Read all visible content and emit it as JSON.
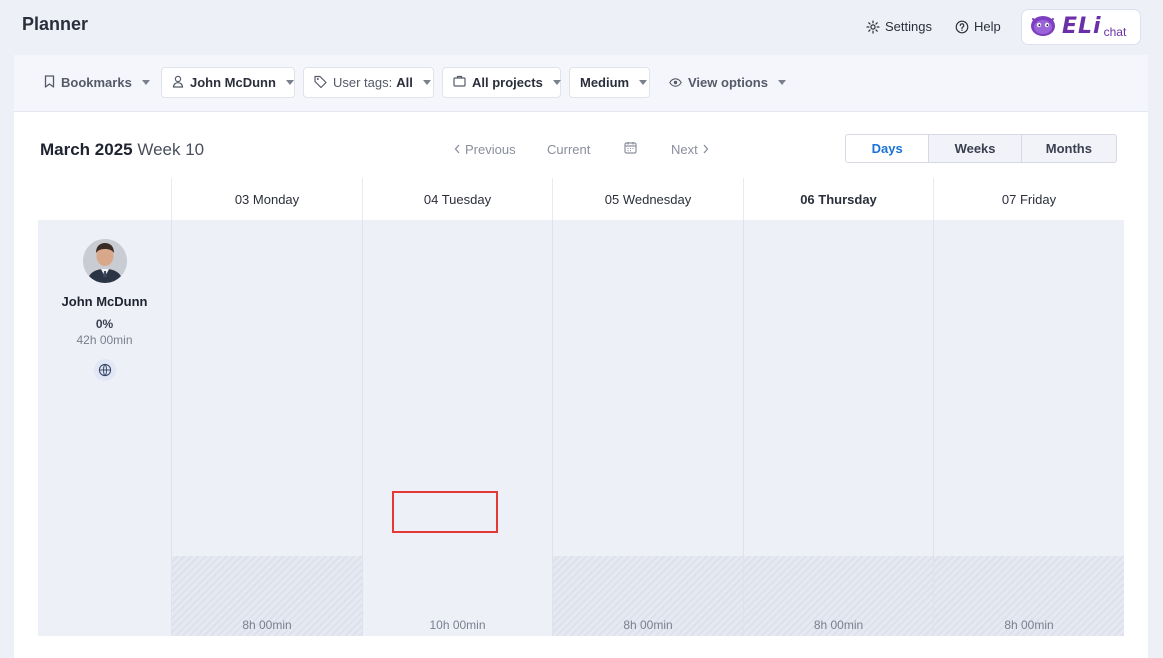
{
  "header": {
    "title": "Planner",
    "settings_label": "Settings",
    "help_label": "Help",
    "brand": {
      "word": "ELi",
      "suffix": "chat",
      "color": "#6b2fa8"
    }
  },
  "toolbar": {
    "bookmarks_label": "Bookmarks",
    "user_label": "John McDunn",
    "user_tags_prefix": "User tags:",
    "user_tags_value": "All",
    "projects_label": "All projects",
    "size_label": "Medium",
    "view_options_label": "View options"
  },
  "period": {
    "month_label": "March 2025",
    "week_label": "Week 10",
    "previous_label": "Previous",
    "current_label": "Current",
    "next_label": "Next"
  },
  "view_modes": [
    {
      "label": "Days",
      "active": true
    },
    {
      "label": "Weeks",
      "active": false
    },
    {
      "label": "Months",
      "active": false
    }
  ],
  "days": [
    {
      "label": "03 Monday",
      "capacity": "8h 00min",
      "today": false,
      "hatched": true
    },
    {
      "label": "04 Tuesday",
      "capacity": "10h 00min",
      "today": false,
      "hatched": false
    },
    {
      "label": "05 Wednesday",
      "capacity": "8h 00min",
      "today": false,
      "hatched": true
    },
    {
      "label": "06 Thursday",
      "capacity": "8h 00min",
      "today": true,
      "hatched": true
    },
    {
      "label": "07 Friday",
      "capacity": "8h 00min",
      "today": false,
      "hatched": true
    }
  ],
  "user": {
    "name": "John McDunn",
    "utilization": "0%",
    "hours": "42h 00min"
  },
  "colors": {
    "accent": "#1a73d9",
    "highlight": "#e53935"
  }
}
